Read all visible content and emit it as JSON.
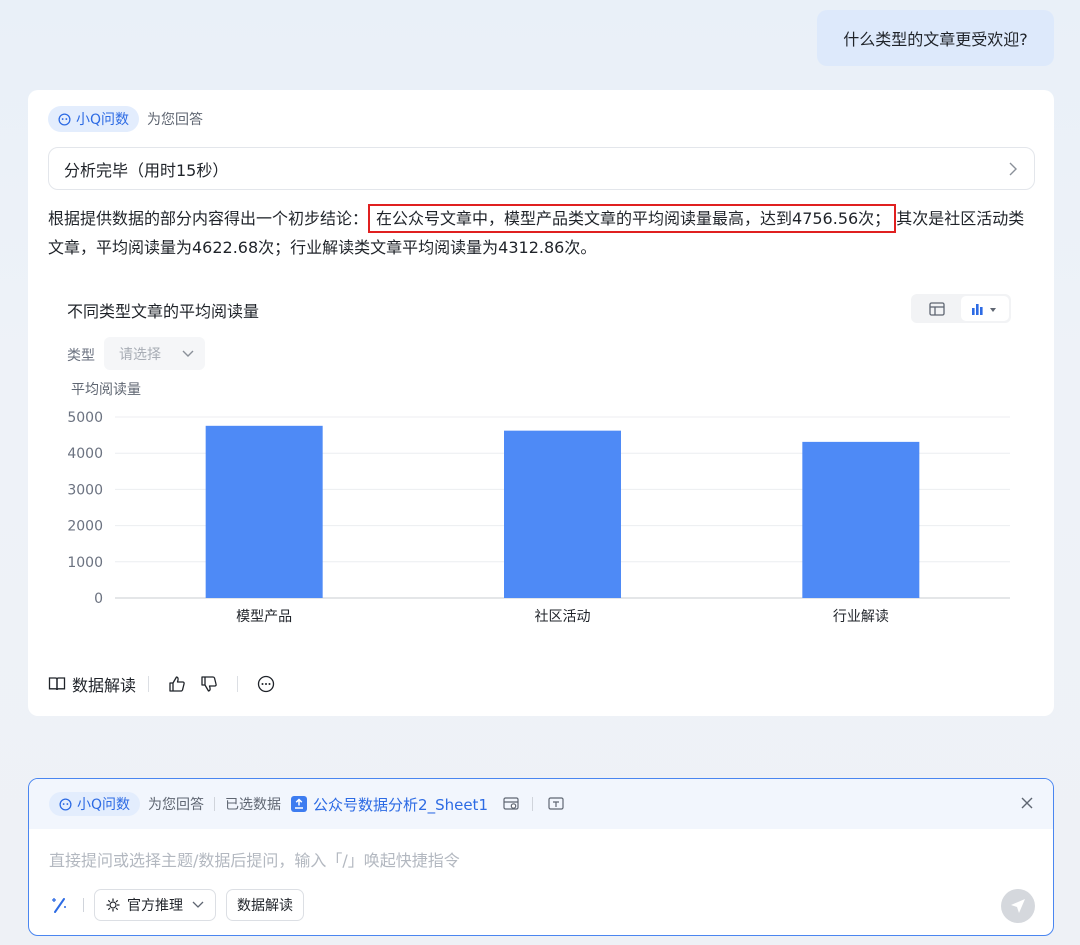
{
  "question": "什么类型的文章更受欢迎?",
  "answer": {
    "badge": "小Q问数",
    "for_you": "为您回答",
    "analysis_status": "分析完毕（用时15秒）",
    "conclusion_prefix": "根据提供数据的部分内容得出一个初步结论：",
    "conclusion_highlight": "在公众号文章中，模型产品类文章的平均阅读量最高，达到4756.56次；",
    "conclusion_suffix": "其次是社区活动类文章，平均阅读量为4622.68次；行业解读类文章平均阅读量为4312.86次。",
    "filter_label": "类型",
    "filter_placeholder": "请选择",
    "actions": {
      "interpret": "数据解读"
    }
  },
  "chart_data": {
    "type": "bar",
    "title": "不同类型文章的平均阅读量",
    "ylabel": "平均阅读量",
    "xlabel": "",
    "categories": [
      "模型产品",
      "社区活动",
      "行业解读"
    ],
    "values": [
      4756.56,
      4622.68,
      4312.86
    ],
    "yticks": [
      0,
      1000,
      2000,
      3000,
      4000,
      5000
    ],
    "ylim": [
      0,
      5000
    ],
    "grid": true,
    "legend": "none",
    "bar_color": "#4e8af6"
  },
  "input": {
    "badge": "小Q问数",
    "for_you": "为您回答",
    "selected_label": "已选数据",
    "file_name": "公众号数据分析2_Sheet1",
    "placeholder": "直接提问或选择主题/数据后提问，输入「/」唤起快捷指令",
    "mode": "官方推理",
    "interpret": "数据解读"
  },
  "colors": {
    "accent": "#2d6be4",
    "highlight_border": "#e02020",
    "bubble": "#dde9fb"
  }
}
